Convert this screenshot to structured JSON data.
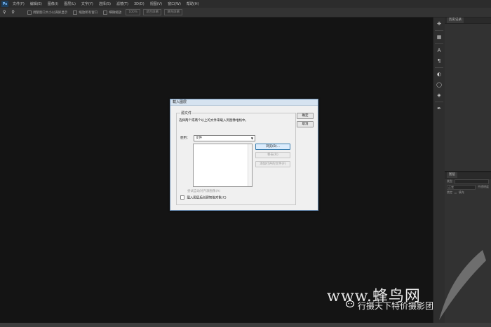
{
  "menubar": {
    "logo": "Ps",
    "items": [
      "文件(F)",
      "编辑(E)",
      "图像(I)",
      "图层(L)",
      "文字(Y)",
      "选择(S)",
      "滤镜(T)",
      "3D(D)",
      "视图(V)",
      "窗口(W)",
      "帮助(H)"
    ]
  },
  "optbar": {
    "resize_window": "调整窗口大小以满屏显示",
    "zoom_all": "缩放所有窗口",
    "scrubby": "细微缩放",
    "actual_pixels": "100%",
    "fit_screen": "适合屏幕",
    "fill_screen": "填充屏幕"
  },
  "panels": {
    "history_tab": "历史记录",
    "layers_tab": "图层",
    "layers_kind": "类型",
    "layers_mode": "正常",
    "layers_opacity": "不透明度",
    "layers_lock": "锁定",
    "layers_fill": "填充"
  },
  "dialog": {
    "title": "载入图层",
    "group_label": "源文件",
    "instruction": "选择两个或两个以上的文件来载入到图像堆栈中。",
    "use_label": "使用：",
    "use_value": "文件",
    "browse": "浏览(B)...",
    "remove": "移去(R)",
    "add_open": "添加打开的文件(F)",
    "ok": "确定",
    "cancel": "取消",
    "auto_align": "尝试自动对齐源图像(A)",
    "smart_object": "载入图层后创建智能对象(C)"
  },
  "watermark": {
    "site": "www.蜂鸟网",
    "account": "行摄天下特价摄影团"
  }
}
